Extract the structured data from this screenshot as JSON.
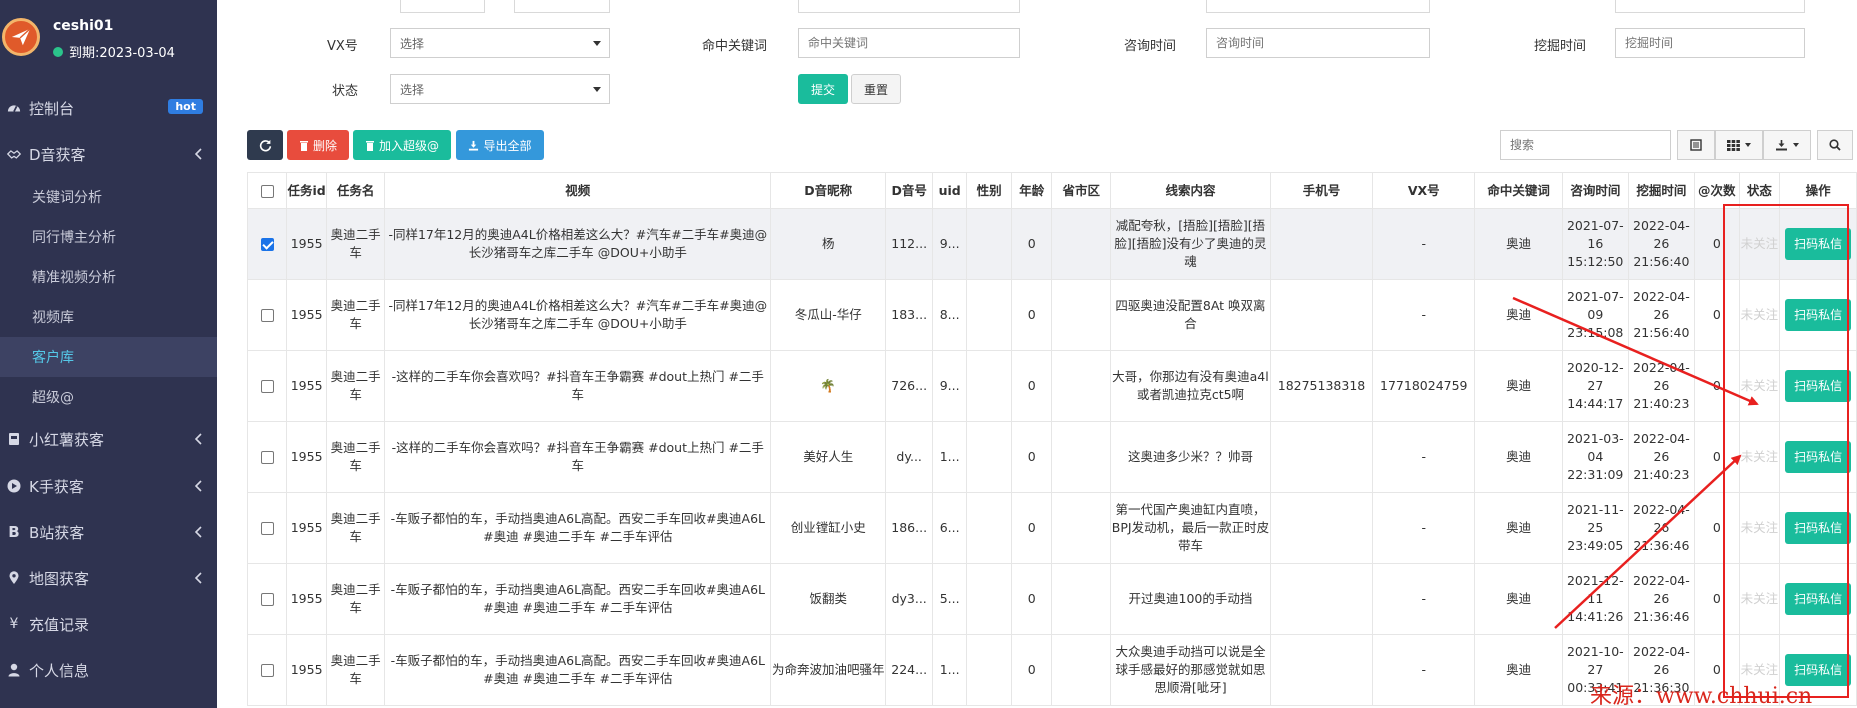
{
  "sidebar": {
    "username": "ceshi01",
    "expire": "到期:2023-03-04",
    "menu": [
      {
        "label": "控制台",
        "badge": "hot"
      },
      {
        "label": "D音获客"
      },
      {
        "label": "小红薯获客"
      },
      {
        "label": "K手获客"
      },
      {
        "label": "B站获客"
      },
      {
        "label": "地图获客"
      },
      {
        "label": "充值记录"
      },
      {
        "label": "个人信息"
      }
    ],
    "submenu": [
      "关键词分析",
      "同行博主分析",
      "精准视频分析",
      "视频库",
      "客户库",
      "超级@"
    ]
  },
  "filters": {
    "vx_label": "VX号",
    "vx_value": "选择",
    "keyword_label": "命中关键词",
    "keyword_placeholder": "命中关键词",
    "consult_label": "咨询时间",
    "consult_placeholder": "咨询时间",
    "mine_label": "挖掘时间",
    "mine_placeholder": "挖掘时间",
    "status_label": "状态",
    "status_value": "选择",
    "submit": "提交",
    "reset": "重置"
  },
  "toolbar": {
    "delete": "删除",
    "add_super": "加入超级@",
    "export_all": "导出全部",
    "search_placeholder": "搜索"
  },
  "table": {
    "headers": [
      "任务id",
      "任务名",
      "视频",
      "D音昵称",
      "D音号",
      "uid",
      "性别",
      "年龄",
      "省市区",
      "线索内容",
      "手机号",
      "VX号",
      "命中关键词",
      "咨询时间",
      "挖掘时间",
      "@次数",
      "状态",
      "操作"
    ],
    "rows": [
      {
        "selected": true,
        "id": "1955",
        "task": "奥迪二手车",
        "video": "-同样17年12月的奥迪A4L价格相差这么大？#汽车#二手车#奥迪@长沙猪哥车之库二手车 @DOU+小助手",
        "nickname": "杨",
        "dy": "112...",
        "uid": "9...",
        "gender": "",
        "age": "0",
        "region": "",
        "clue": "减配夸秋，[捂脸][捂脸][捂脸][捂脸]没有少了奥迪的灵魂",
        "phone": "",
        "vx": "-",
        "kw": "奥迪",
        "consult": "2021-07-16 15:12:50",
        "mine": "2022-04-26 21:56:40",
        "at": "0",
        "status": "未关注",
        "op": "扫码私信"
      },
      {
        "selected": false,
        "id": "1955",
        "task": "奥迪二手车",
        "video": "-同样17年12月的奥迪A4L价格相差这么大？#汽车#二手车#奥迪@长沙猪哥车之库二手车 @DOU+小助手",
        "nickname": "冬瓜山-华仔",
        "dy": "183...",
        "uid": "8...",
        "gender": "",
        "age": "0",
        "region": "",
        "clue": "四驱奥迪没配置8At 唤双离合",
        "phone": "",
        "vx": "-",
        "kw": "奥迪",
        "consult": "2021-07-09 23:15:08",
        "mine": "2022-04-26 21:56:40",
        "at": "0",
        "status": "未关注",
        "op": "扫码私信"
      },
      {
        "selected": false,
        "id": "1955",
        "task": "奥迪二手车",
        "video": "-这样的二手车你会喜欢吗？#抖音车王争霸赛 #dout上热门 #二手车",
        "nickname": "🌴",
        "dy": "726...",
        "uid": "9...",
        "gender": "",
        "age": "0",
        "region": "",
        "clue": "大哥，你那边有没有奥迪a4l或者凯迪拉克ct5啊",
        "phone": "18275138318",
        "vx": "17718024759",
        "kw": "奥迪",
        "consult": "2020-12-27 14:44:17",
        "mine": "2022-04-26 21:40:23",
        "at": "0",
        "status": "未关注",
        "op": "扫码私信"
      },
      {
        "selected": false,
        "id": "1955",
        "task": "奥迪二手车",
        "video": "-这样的二手车你会喜欢吗？#抖音车王争霸赛 #dout上热门 #二手车",
        "nickname": "美好人生",
        "dy": "dy...",
        "uid": "1...",
        "gender": "",
        "age": "0",
        "region": "",
        "clue": "这奥迪多少米？？帅哥",
        "phone": "",
        "vx": "-",
        "kw": "奥迪",
        "consult": "2021-03-04 22:31:09",
        "mine": "2022-04-26 21:40:23",
        "at": "0",
        "status": "未关注",
        "op": "扫码私信"
      },
      {
        "selected": false,
        "id": "1955",
        "task": "奥迪二手车",
        "video": "-车贩子都怕的车，手动挡奥迪A6L高配。西安二手车回收#奥迪A6L #奥迪 #奥迪二手车 #二手车评估",
        "nickname": "创业镗缸小史",
        "dy": "186...",
        "uid": "6...",
        "gender": "",
        "age": "0",
        "region": "",
        "clue": "第一代国产奥迪缸内直喷，BPJ发动机，最后一款正时皮带车",
        "phone": "",
        "vx": "-",
        "kw": "奥迪",
        "consult": "2021-11-25 23:49:05",
        "mine": "2022-04-26 21:36:46",
        "at": "0",
        "status": "未关注",
        "op": "扫码私信"
      },
      {
        "selected": false,
        "id": "1955",
        "task": "奥迪二手车",
        "video": "-车贩子都怕的车，手动挡奥迪A6L高配。西安二手车回收#奥迪A6L #奥迪 #奥迪二手车 #二手车评估",
        "nickname": "饭翻类",
        "dy": "dy3...",
        "uid": "5...",
        "gender": "",
        "age": "0",
        "region": "",
        "clue": "开过奥迪100的手动挡",
        "phone": "",
        "vx": "-",
        "kw": "奥迪",
        "consult": "2021-12-11 14:41:26",
        "mine": "2022-04-26 21:36:46",
        "at": "0",
        "status": "未关注",
        "op": "扫码私信"
      },
      {
        "selected": false,
        "id": "1955",
        "task": "奥迪二手车",
        "video": "-车贩子都怕的车，手动挡奥迪A6L高配。西安二手车回收#奥迪A6L #奥迪 #奥迪二手车 #二手车评估",
        "nickname": "为命奔波加油吧骚年",
        "dy": "224...",
        "uid": "1...",
        "gender": "",
        "age": "0",
        "region": "",
        "clue": "大众奥迪手动挡可以说是全球手感最好的那感觉就如思思顺滑[呲牙]",
        "phone": "",
        "vx": "-",
        "kw": "奥迪",
        "consult": "2021-10-27 00:33:41",
        "mine": "2022-04-26 21:36:30",
        "at": "0",
        "status": "未关注",
        "op": "扫码私信"
      }
    ]
  },
  "watermark": "来源：www.chhui.cn",
  "colors": {
    "sidebar_bg": "#2f3350",
    "accent_green": "#1abc9c",
    "annotation_red": "#e8201f"
  }
}
